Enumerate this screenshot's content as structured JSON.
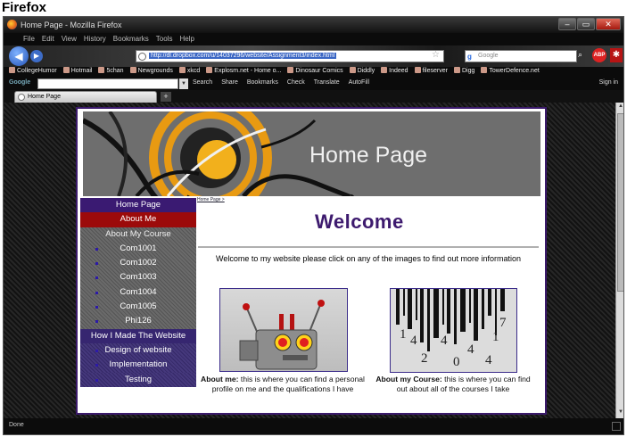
{
  "caption": "Firefox",
  "window": {
    "title": "Home Page - Mozilla Firefox",
    "buttons": {
      "minimize": "–",
      "maximize": "▭",
      "close": "✕"
    }
  },
  "menu": [
    "File",
    "Edit",
    "View",
    "History",
    "Bookmarks",
    "Tools",
    "Help"
  ],
  "nav": {
    "url": "http://dl.dropbox.com/u/14037296/website/Assignment3/index.html",
    "search_placeholder": "Google"
  },
  "bookmarks": [
    "CollegeHumor",
    "Hotmail",
    "5chan",
    "Newgrounds",
    "xkcd",
    "Explosm.net - Home o...",
    "Dinosaur Comics",
    "Diddly",
    "Indeed",
    "fileserver",
    "Digg",
    "TowerDefence.net"
  ],
  "google_toolbar": {
    "logo": "Google",
    "items": [
      "Search",
      "Share",
      "Bookmarks",
      "Check",
      "Translate",
      "AutoFill"
    ],
    "signin": "Sign in"
  },
  "tab": {
    "title": "Home Page",
    "new_tab": "+"
  },
  "page": {
    "banner_title": "Home Page",
    "sidebar": {
      "home": "Home Page",
      "about": "About Me",
      "course_header": "About My Course",
      "courses": [
        "Com1001",
        "Com1002",
        "Com1003",
        "Com1004",
        "Com1005",
        "Phi126"
      ],
      "made_header": "How I Made The Website",
      "made_items": [
        "Design of website",
        "Implementation",
        "Testing"
      ]
    },
    "breadcrumb": "Home Page >",
    "welcome": "Welcome",
    "intro": "Welcome to my website please click on any of the images to find out more information",
    "cards": {
      "about_title": "About me:",
      "about_text": " this is where you can find a personal profile on me and the qualifications I have",
      "course_title": "About my Course:",
      "course_text": " this is where you can find out about all of the courses I take"
    },
    "barcode_digits": [
      "1",
      "4",
      "7",
      "1",
      "4",
      "2",
      "0",
      "4",
      "4"
    ]
  },
  "status": "Done"
}
